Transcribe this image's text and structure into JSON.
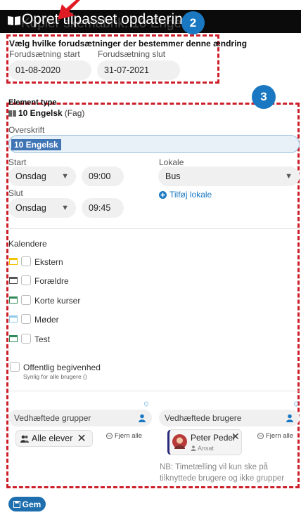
{
  "header": {
    "title": "Opret tilpasset opdatering",
    "ghost_title": "Kopier skemabrik: 10 Engelsk"
  },
  "badges": {
    "first": "2",
    "second": "3"
  },
  "premises": {
    "heading": "Vælg hvilke forudsætninger der bestemmer denne ændring",
    "start_label": "Forudsætning start",
    "start_value": "01-08-2020",
    "end_label": "Forudsætning slut",
    "end_value": "31-07-2021"
  },
  "element": {
    "type_label": "Element type",
    "type_value": "10 Engelsk",
    "type_suffix": "(Fag)"
  },
  "overskrift": {
    "label": "Overskrift",
    "value": "10 Engelsk"
  },
  "start": {
    "label": "Start",
    "day": "Onsdag",
    "time": "09:00"
  },
  "slut": {
    "label": "Slut",
    "day": "Onsdag",
    "time": "09:45"
  },
  "lokale": {
    "label": "Lokale",
    "value": "Bus",
    "add_link": "Tilføj lokale"
  },
  "kalendere": {
    "label": "Kalendere",
    "items": [
      {
        "label": "Ekstern",
        "color": "#f2c300"
      },
      {
        "label": "Forældre",
        "color": "#555555"
      },
      {
        "label": "Korte kurser",
        "color": "#2e8b57"
      },
      {
        "label": "Møder",
        "color": "#8ec9e8"
      },
      {
        "label": "Test",
        "color": "#2e8b57"
      }
    ]
  },
  "public_event": {
    "label": "Offentlig begivenhed",
    "sub": "Synlig for alle brugere ()"
  },
  "groups": {
    "header": "Vedhæftede grupper",
    "tag": "Alle elever",
    "remove_all": "Fjern alle"
  },
  "users": {
    "header": "Vedhæftede brugere",
    "name": "Peter Pedel",
    "role": "Ansat",
    "remove_all": "Fjern alle",
    "note": "NB: Timetælling vil kun ske på tilknyttede brugere og ikke grupper"
  },
  "footer": {
    "save_label": "Gem"
  },
  "colors": {
    "accent": "#1a78c2",
    "highlight": "#cc1f2a",
    "title_bg": "#0b0b0b"
  }
}
